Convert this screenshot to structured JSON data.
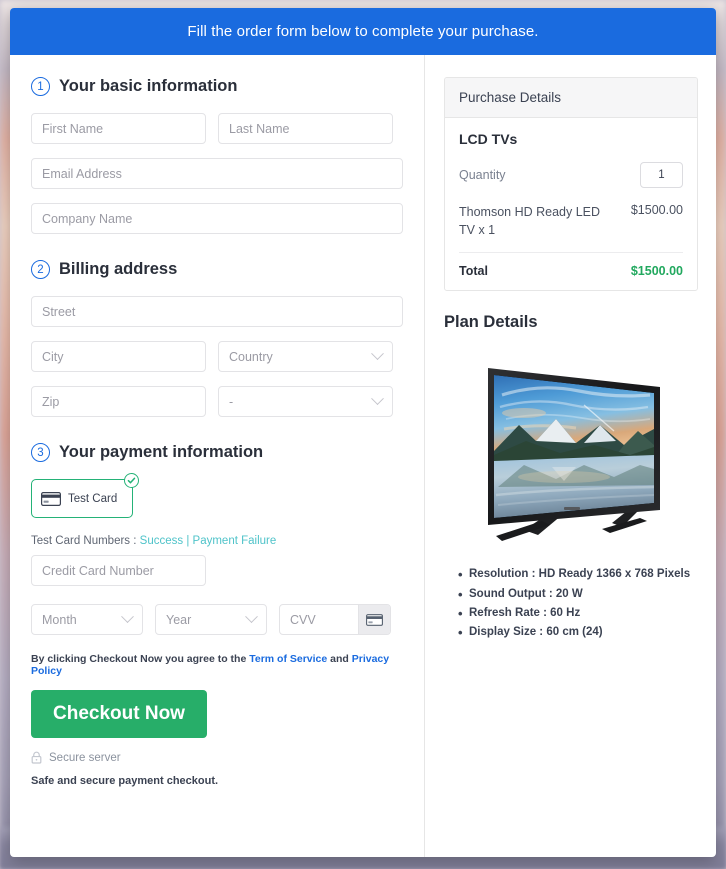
{
  "banner": {
    "text": "Fill the order form below to complete your purchase."
  },
  "sections": {
    "basic": {
      "num": "1",
      "title": "Your basic information"
    },
    "billing": {
      "num": "2",
      "title": "Billing address"
    },
    "payment": {
      "num": "3",
      "title": "Your payment information"
    }
  },
  "fields": {
    "first_name": "First Name",
    "last_name": "Last Name",
    "email": "Email Address",
    "company": "Company Name",
    "street": "Street",
    "city": "City",
    "country": "Country",
    "zip": "Zip",
    "state": "-",
    "card_number": "Credit Card Number",
    "month": "Month",
    "year": "Year",
    "cvv": "CVV"
  },
  "payment": {
    "card_option_label": "Test  Card",
    "test_numbers_prefix": "Test Card Numbers :",
    "success_link": "Success",
    "separator": "|",
    "failure_link": "Payment Failure"
  },
  "terms": {
    "prefix": "By clicking Checkout Now you agree to the",
    "tos_link": "Term of Service",
    "conjunction": "and",
    "privacy_link": "Privacy Policy"
  },
  "actions": {
    "checkout_label": "Checkout Now",
    "secure_server": "Secure server",
    "safe_note": "Safe and secure payment checkout."
  },
  "purchase": {
    "panel_title": "Purchase Details",
    "product_name": "LCD TVs",
    "quantity_label": "Quantity",
    "quantity_value": "1",
    "line_item_desc": "Thomson HD Ready LED TV x 1",
    "line_item_amount": "$1500.00",
    "total_label": "Total",
    "total_amount": "$1500.00"
  },
  "plan": {
    "title": "Plan Details",
    "specs": [
      "Resolution : HD Ready 1366 x 768 Pixels",
      "Sound Output : 20 W",
      "Refresh Rate : 60 Hz",
      "Display Size : 60 cm (24)"
    ]
  },
  "colors": {
    "banner_blue": "#1a6bdf",
    "accent_green": "#27ae69",
    "total_green": "#21a85e",
    "link_blue": "#1a6bdf",
    "link_teal": "#4fc3c9"
  }
}
